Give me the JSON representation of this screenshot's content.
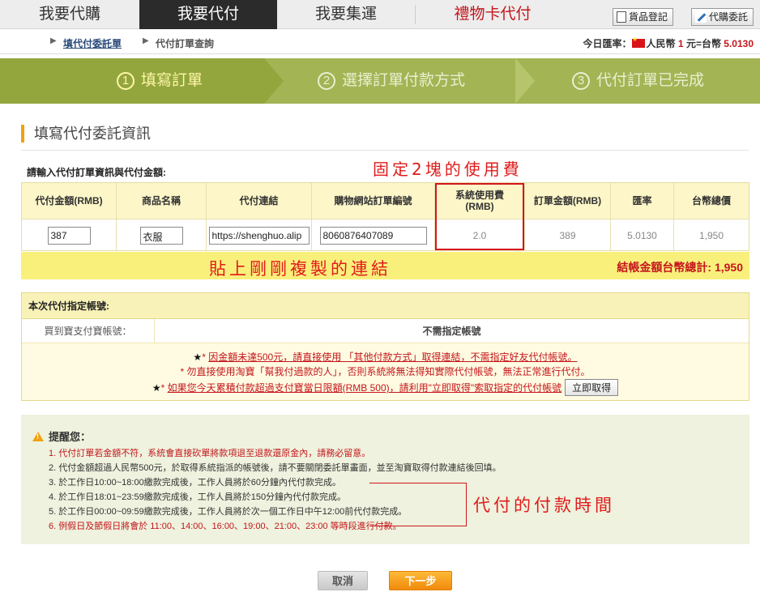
{
  "nav": {
    "tabs": [
      "我要代購",
      "我要代付",
      "我要集運",
      "禮物卡代付"
    ],
    "active_index": 1,
    "goods_register": "貨品登記",
    "purchase_entrust": "代購委託"
  },
  "breadcrumb": {
    "item1": "填代付委託單",
    "item2": "代付訂單查詢"
  },
  "rate": {
    "label": "今日匯率：",
    "rmb": "人民幣",
    "one": "1",
    "yuan_eq": "元=台幣",
    "value": "5.0130"
  },
  "steps": [
    {
      "num": "①",
      "label": "填寫訂單"
    },
    {
      "num": "②",
      "label": "選擇訂單付款方式"
    },
    {
      "num": "③",
      "label": "代付訂單已完成"
    }
  ],
  "section_title": "填寫代付委託資訊",
  "instruction": "請輸入代付訂單資訊與代付金額:",
  "annotations": {
    "fee": "固定2塊的使用費",
    "paste": "貼上剛剛複製的連結",
    "time": "代付的付款時間"
  },
  "order_table": {
    "headers": [
      "代付金額(RMB)",
      "商品名稱",
      "代付連結",
      "購物網站訂單編號",
      "系統使用費(RMB)",
      "訂單金額(RMB)",
      "匯率",
      "台幣總價"
    ],
    "amount": "387",
    "product": "衣服",
    "link": "https://shenghuo.alip",
    "order_no": "806087640708​9",
    "fee": "2.0",
    "order_amount": "389",
    "rate": "5.0130",
    "twd_total": "1,950"
  },
  "total": {
    "label": "結帳金額台幣總計:",
    "value": "1,950"
  },
  "account": {
    "title": "本次代付指定帳號:",
    "row_label": "買到寶支付寶帳號：",
    "row_value": "不需指定帳號",
    "note1_prefix": "* ",
    "note1": "因金額未達500元，請直接使用 「其他付款方式」取得連結，不需指定好友代付帳號。",
    "note2": "* 勿直接使用淘寶「幫我付過款的人」，否則系統將無法得知實際代付帳號，無法正常進行代付。",
    "note3_prefix": "* ",
    "note3": "如果您今天累積付款超過支付寶當日限額(RMB 500)，請利用\"立即取得\"索取指定的代付帳號",
    "get_button": "立即取得"
  },
  "reminder": {
    "title": "提醒您：",
    "items": [
      "1. 代付訂單若金額不符，系統會直接砍單將款項退至退款還原金內，請務必留意。",
      "2. 代付金額超過人民幣500元，於取得系統指派的帳號後，請不要關閉委託單畫面，並至淘寶取得付款連結後回填。",
      "3. 於工作日10:00~18:00繳款完成後，工作人員將於60分鐘內代付款完成。",
      "4. 於工作日18:01~23:59繳款完成後，工作人員將於150分鐘內代付款完成。",
      "5. 於工作日00:00~09:59繳款完成後，工作人員將於次一個工作日中午12:00前代付款完成。",
      "6. 例假日及節假日將會於 11:00、14:00、16:00、19:00、21:00、23:00 等時段進行付款。"
    ]
  },
  "buttons": {
    "cancel": "取消",
    "next": "下一步"
  },
  "colors": {
    "accent_red": "#c4161c",
    "steps_green": "#a3b455",
    "highlight_yellow": "#f9f07c",
    "next_orange": "#f08a0b"
  }
}
